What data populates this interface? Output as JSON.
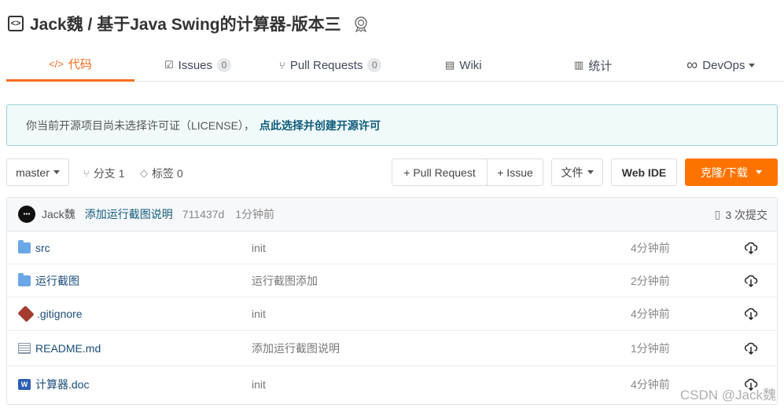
{
  "repo": {
    "title": "Jack魏 / 基于Java Swing的计算器-版本三"
  },
  "tabs": [
    {
      "label": "代码",
      "icon": "code-icon",
      "active": true
    },
    {
      "label": "Issues",
      "count": "0",
      "icon": "issues-icon"
    },
    {
      "label": "Pull Requests",
      "count": "0",
      "icon": "pull-request-icon"
    },
    {
      "label": "Wiki",
      "icon": "wiki-icon"
    },
    {
      "label": "统计",
      "icon": "chart-icon"
    },
    {
      "label": "DevOps",
      "icon": "infinity-icon"
    }
  ],
  "notice": {
    "text": "你当前开源项目尚未选择许可证（LICENSE），",
    "link": "点此选择并创建开源许可"
  },
  "toolbar": {
    "branch": "master",
    "branches": "分支 1",
    "tags": "标签 0",
    "pull_request": "+ Pull Request",
    "issue": "+ Issue",
    "files": "文件",
    "web_ide": "Web IDE",
    "clone": "克隆/下载"
  },
  "commit": {
    "author": "Jack魏",
    "message": "添加运行截图说明",
    "hash": "711437d",
    "time": "1分钟前",
    "count": "3 次提交"
  },
  "files": [
    {
      "name": "src",
      "type": "folder",
      "message": "init",
      "time": "4分钟前"
    },
    {
      "name": "运行截图",
      "type": "folder",
      "message": "运行截图添加",
      "time": "2分钟前"
    },
    {
      "name": ".gitignore",
      "type": "git",
      "message": "init",
      "time": "4分钟前"
    },
    {
      "name": "README.md",
      "type": "readme",
      "message": "添加运行截图说明",
      "time": "1分钟前"
    },
    {
      "name": "计算器.doc",
      "type": "word",
      "message": "init",
      "time": "4分钟前"
    }
  ],
  "watermark": "CSDN @Jack魏",
  "colors": {
    "accent": "#f56c1f",
    "clone": "#fe7300",
    "link": "#0f5b7a"
  }
}
